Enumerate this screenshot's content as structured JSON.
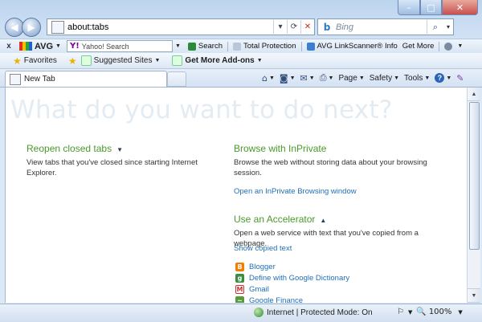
{
  "nav": {
    "address_url": "about:tabs",
    "search_placeholder": "Bing"
  },
  "avg_toolbar": {
    "close_glyph": "x",
    "avg_label": "AVG",
    "yahoo_placeholder": "Yahoo! Search",
    "search_label": "Search",
    "total_protection_label": "Total Protection",
    "linkscanner_label": "AVG LinkScanner® Info",
    "get_more_label": "Get More"
  },
  "favorites_bar": {
    "favorites_label": "Favorites",
    "suggested_sites_label": "Suggested Sites",
    "addons_label": "Get More Add-ons"
  },
  "tabs": {
    "active_tab_label": "New Tab"
  },
  "command_bar": {
    "page_label": "Page",
    "safety_label": "Safety",
    "tools_label": "Tools"
  },
  "content": {
    "headline": "What do you want to do next?",
    "reopen": {
      "title": "Reopen closed tabs",
      "description": "View tabs that you've closed since starting Internet Explorer."
    },
    "inprivate": {
      "title": "Browse with InPrivate",
      "description": "Browse the web without storing data about your browsing session.",
      "link": "Open an InPrivate Browsing window"
    },
    "accelerator": {
      "title": "Use an Accelerator",
      "description": "Open a web service with text that you've copied from a webpage.",
      "show_copied": "Show copied text",
      "services": [
        "Blogger",
        "Define with Google Dictionary",
        "Gmail",
        "Google Finance"
      ]
    }
  },
  "status_bar": {
    "zone_text": "Internet | Protected Mode: On",
    "zoom_text": "100%"
  },
  "colors": {
    "accent_green": "#4a9a2a",
    "link_blue": "#1e6fb8",
    "headline_gray": "#e3ebf3"
  }
}
